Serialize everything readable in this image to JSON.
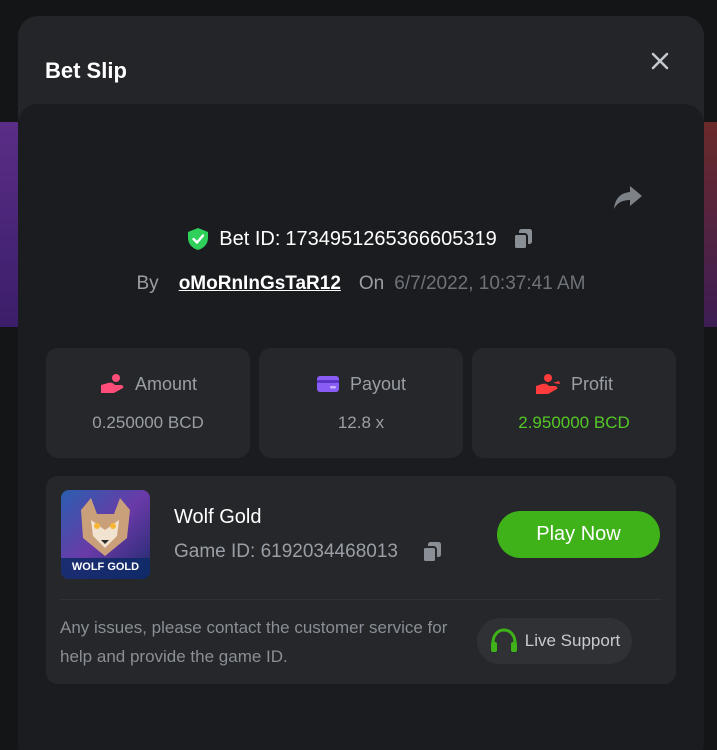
{
  "modal": {
    "title": "Bet Slip"
  },
  "bet": {
    "id_label": "Bet ID:",
    "id_value": "1734951265366605319",
    "by_label": "By",
    "user": "oMoRnInGsTaR12",
    "on_label": "On",
    "datetime": "6/7/2022, 10:37:41 AM"
  },
  "stats": [
    {
      "label": "Amount",
      "value": "0.250000 BCD",
      "icon": "hand-coins-icon"
    },
    {
      "label": "Payout",
      "value": "12.8 x",
      "icon": "card-icon"
    },
    {
      "label": "Profit",
      "value": "2.950000 BCD",
      "icon": "hand-money-icon"
    }
  ],
  "game": {
    "name": "Wolf Gold",
    "id_label": "Game ID:",
    "id_value": "6192034468013",
    "thumb_text": "WOLF GOLD",
    "play_label": "Play Now"
  },
  "support": {
    "notice": "Any issues, please contact the customer service for help and provide the game ID.",
    "button_label": "Live Support"
  },
  "colors": {
    "accent_green": "#3fb219",
    "profit_green": "#54c826",
    "shield_green": "#2fd05a",
    "amount_icon": "#ff4d7a",
    "payout_icon": "#8a5cf6",
    "profit_icon": "#ff3b3b"
  }
}
